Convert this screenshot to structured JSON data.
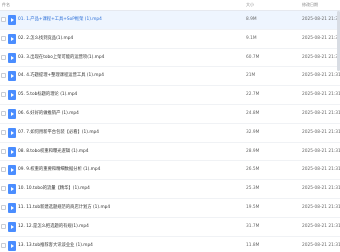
{
  "header": {
    "name_label": "件名",
    "size_label": "大小",
    "date_label": "修改日期"
  },
  "files": [
    {
      "name": "01. 1.产品+课程+工具+SoP框架 (1).mp4",
      "size": "8.9M",
      "date": "2025-08-21 21:31",
      "selected": true
    },
    {
      "name": "02. 2.怎么找到竞品(1).mp4",
      "size": "9.1M",
      "date": "2025-08-21 21:31",
      "selected": false
    },
    {
      "name": "03. 3.出现在tobo上架可能的运营项(1).mp4",
      "size": "60.7M",
      "date": "2025-08-21 21:31",
      "selected": false
    },
    {
      "name": "04. 4.巧题提理+整理课程运营工具 (1).mp4",
      "size": "21M",
      "date": "2025-08-21 21:31",
      "selected": false
    },
    {
      "name": "05. 5.tob标题的理论 (1).mp4",
      "size": "22.7M",
      "date": "2025-08-21 21:31",
      "selected": false
    },
    {
      "name": "06. 6.好好的做推销产 (1).mp4",
      "size": "24.8M",
      "date": "2025-08-21 21:31",
      "selected": false
    },
    {
      "name": "07. 7.如何用新平台包装【必看】(1).mp4",
      "size": "32.9M",
      "date": "2025-08-21 21:31",
      "selected": false
    },
    {
      "name": "08. 8.tobo权重和曝光逻辑 (1).mp4",
      "size": "28.9M",
      "date": "2025-08-21 21:31",
      "selected": false
    },
    {
      "name": "09. 9.权重的重要和精细数据分析 (1).mp4",
      "size": "26.5M",
      "date": "2025-08-21 21:31",
      "selected": false
    },
    {
      "name": "10. 10.tobo的流量【精华】(1).mp4",
      "size": "25.3M",
      "date": "2025-08-21 21:31",
      "selected": false
    },
    {
      "name": "11. 11.tob新建选题规范的商店计划方 (1).mp4",
      "size": "19.5M",
      "date": "2025-08-21 21:31",
      "selected": false
    },
    {
      "name": "12. 12.是怎么把选题的有规(1).mp4",
      "size": "31.7M",
      "date": "2025-08-21 21:31",
      "selected": false
    },
    {
      "name": "13. 13.tob推荐客大讯谈业业 (1).mp4",
      "size": "11.8M",
      "date": "2025-08-21 21:31",
      "selected": false
    }
  ]
}
